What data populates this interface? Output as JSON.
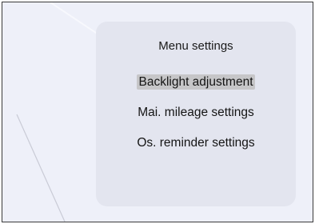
{
  "menu": {
    "title": "Menu settings",
    "items": [
      {
        "label": "Backlight adjustment",
        "selected": true
      },
      {
        "label": "Mai. mileage settings",
        "selected": false
      },
      {
        "label": "Os. reminder settings",
        "selected": false
      }
    ]
  },
  "colors": {
    "screen_background": "#eef0f9",
    "panel_background": "#e3e5ef",
    "selection_highlight": "#c6c6c8",
    "frame_border": "#3a3a3a"
  }
}
